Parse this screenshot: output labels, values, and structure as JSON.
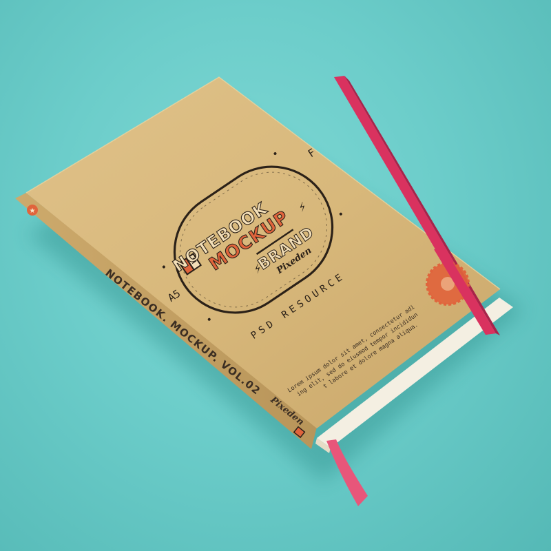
{
  "cover": {
    "title_line1": "NOTEBOOK",
    "title_line2": "MOCKUP",
    "brand": "BRAND",
    "author": "Pixeden",
    "size_left": "A5",
    "size_right": "F",
    "subtitle": "PSD RESOURCE",
    "lorem_1": "Lorem ipsum dolor sit amet, consectetur adi",
    "lorem_2": "ing elit, sed do eiusmod tempor incididun",
    "lorem_3": "t labore et dolore magna aliqua."
  },
  "spine": {
    "title": "NOTEBOOK. MOCKUP. VOL.02",
    "author": "Pixeden"
  },
  "colors": {
    "background": "#6ecfcc",
    "cover": "#d9b87a",
    "elastic_band": "#d9325f",
    "accent_orange": "#e0643c",
    "ink": "#2b2118"
  }
}
